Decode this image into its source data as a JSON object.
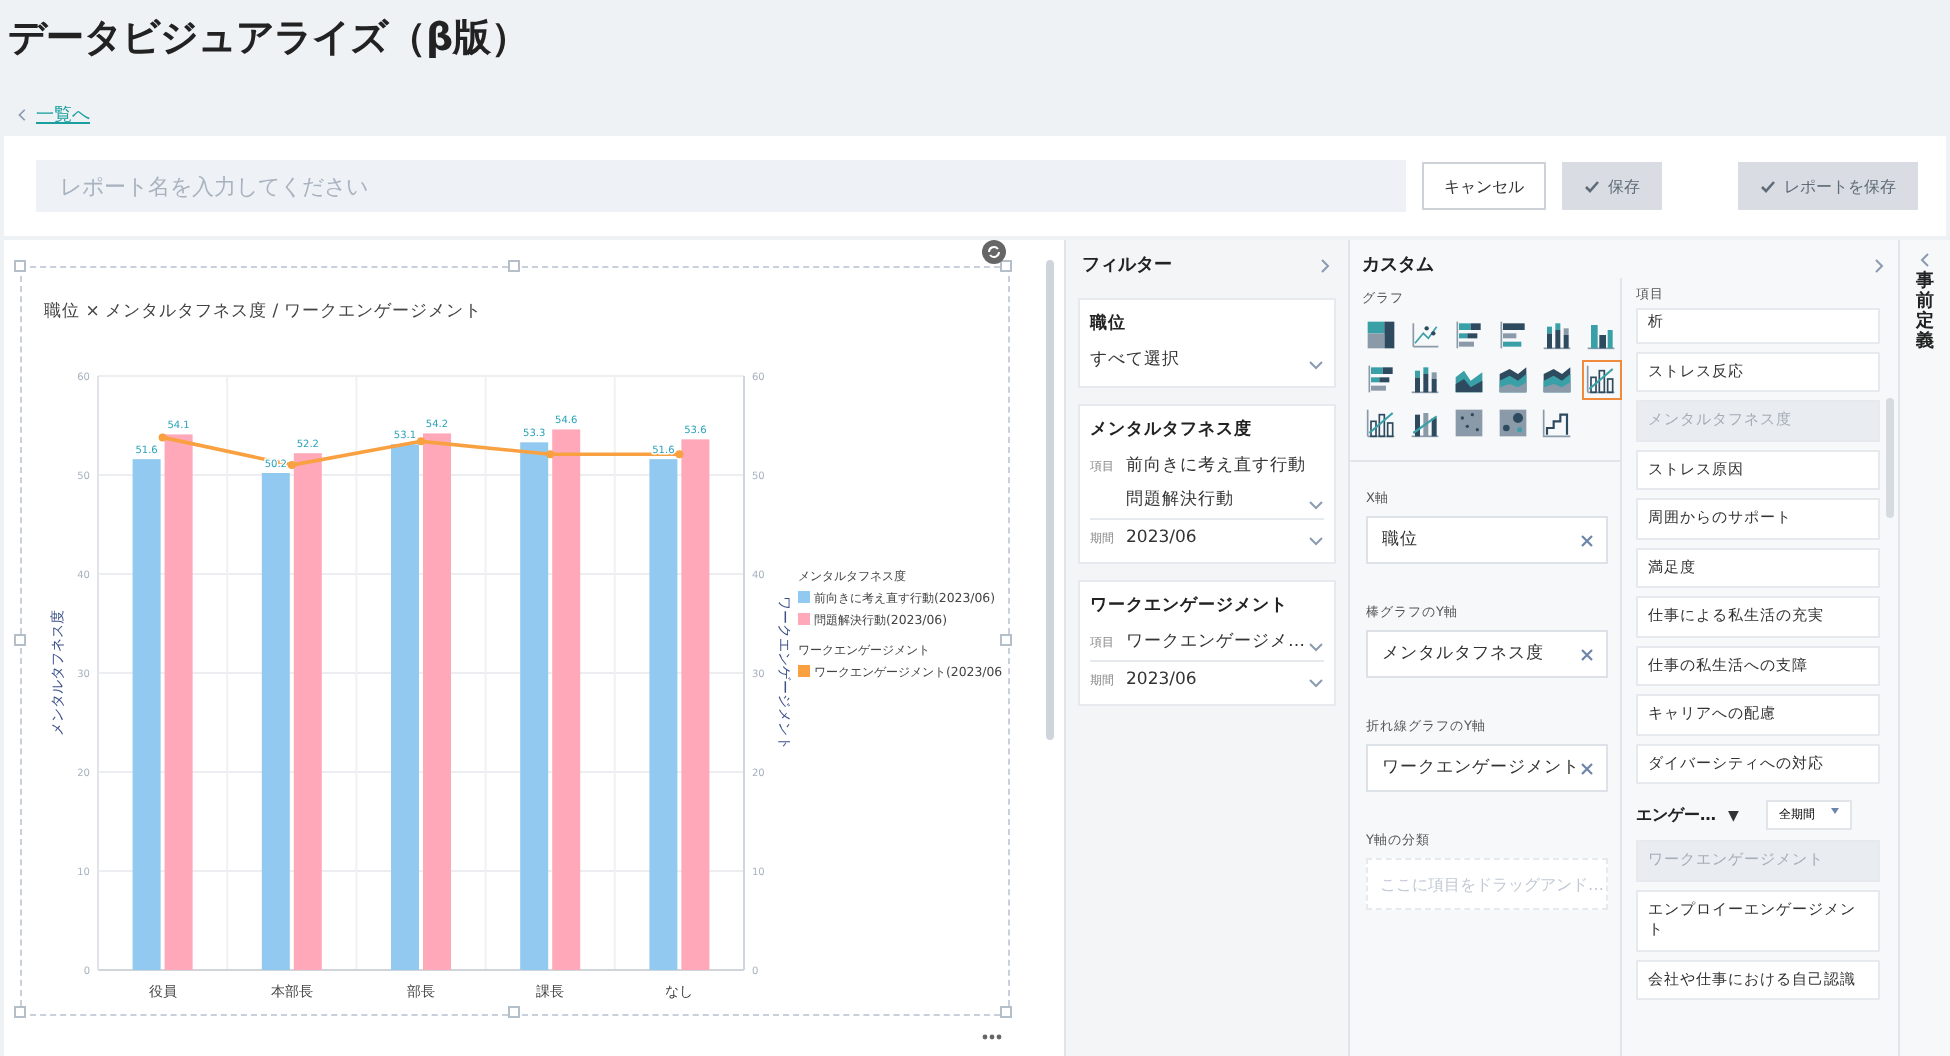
{
  "page": {
    "title": "データビジュアライズ（β版）",
    "back_link": "一覧へ"
  },
  "toolbar": {
    "report_name": {
      "placeholder": "レポート名を入力してください"
    },
    "buttons": [
      {
        "label": "キャンセル",
        "disabled": false
      },
      {
        "label": "保存",
        "disabled": true
      },
      {
        "label": "レポートを保存",
        "disabled": true
      }
    ]
  },
  "chart": {
    "title": "職位 × メンタルタフネス度 / ワークエンゲージメント",
    "legend_headings": {
      "bar": "メンタルタフネス度",
      "line": "ワークエンゲージメント"
    },
    "chart_data": {
      "type": "bar",
      "ylabel": "メンタルタフネス度",
      "y2label": "ワークエンゲージメント",
      "categories": [
        "役員",
        "本部長",
        "部長",
        "課長",
        "なし"
      ],
      "ylim": [
        0,
        60
      ],
      "y2lim": [
        0,
        60
      ],
      "yticks": [
        0,
        10,
        20,
        30,
        40,
        50,
        60
      ],
      "y2ticks": [
        0,
        10,
        20,
        30,
        40,
        50,
        60
      ],
      "grid": true,
      "legend": true,
      "value_labels": [
        [
          "51.6",
          "50.2",
          "53.1",
          "53.3",
          "51.6"
        ],
        [
          "54.1",
          "52.2",
          "54.2",
          "54.6",
          "53.6"
        ],
        [
          null,
          null,
          null,
          null,
          null
        ]
      ],
      "series": [
        {
          "name": "前向きに考え直す行動(2023/06)",
          "type": "bar",
          "color": "#92c9f0",
          "values": [
            51.6,
            50.2,
            53.1,
            53.3,
            51.6
          ]
        },
        {
          "name": "問題解決行動(2023/06)",
          "type": "bar",
          "color": "#ffa8ba",
          "values": [
            54.1,
            52.2,
            54.2,
            54.6,
            53.6
          ]
        },
        {
          "name": "ワークエンゲージメント(2023/06",
          "type": "line",
          "color": "#f9a040",
          "marker": "circle",
          "values": [
            53.8,
            51.0,
            53.4,
            52.1,
            52.1
          ]
        }
      ]
    }
  },
  "filter_panel": {
    "title": "フィルター",
    "filters": [
      {
        "title": "職位",
        "rows": [
          {
            "values": [
              "すべて選択"
            ]
          }
        ]
      },
      {
        "title": "メンタルタフネス度",
        "rows": [
          {
            "label": "項目",
            "values": [
              "前向きに考え直す行動",
              "問題解決行動"
            ]
          },
          {
            "label": "期間",
            "values": [
              "2023/06"
            ]
          }
        ]
      },
      {
        "title": "ワークエンゲージメント",
        "rows": [
          {
            "label": "項目",
            "values": [
              "ワークエンゲージメ…"
            ]
          },
          {
            "label": "期間",
            "values": [
              "2023/06"
            ]
          }
        ]
      }
    ]
  },
  "custom_panel": {
    "title": "カスタム",
    "graph_label": "グラフ",
    "graph_types": [
      {
        "kind": "treemap",
        "selected": false
      },
      {
        "kind": "line-scatter",
        "selected": false
      },
      {
        "kind": "stacked-bar",
        "selected": false
      },
      {
        "kind": "bar",
        "selected": false
      },
      {
        "kind": "stacked-column",
        "selected": false
      },
      {
        "kind": "column",
        "selected": false
      },
      {
        "kind": "stacked-bar",
        "selected": false
      },
      {
        "kind": "stacked-column",
        "selected": false
      },
      {
        "kind": "area",
        "selected": false
      },
      {
        "kind": "stacked-area",
        "selected": false
      },
      {
        "kind": "stacked-area",
        "selected": false
      },
      {
        "kind": "column-line",
        "selected": true
      },
      {
        "kind": "column-line",
        "selected": false
      },
      {
        "kind": "stacked-column-line",
        "selected": false
      },
      {
        "kind": "scatter",
        "selected": false
      },
      {
        "kind": "bubble",
        "selected": false
      },
      {
        "kind": "step",
        "selected": false
      }
    ],
    "axes": [
      {
        "label": "X軸",
        "kind": "chip",
        "value": "職位"
      },
      {
        "label": "棒グラフのY軸",
        "kind": "chip",
        "value": "メンタルタフネス度"
      },
      {
        "label": "折れ線グラフのY軸",
        "kind": "chip",
        "value": "ワークエンゲージメント"
      },
      {
        "label": "Y軸の分類",
        "kind": "drop",
        "placeholder": "ここに項目をドラッグアンド…"
      }
    ]
  },
  "items_panel": {
    "title": "項目",
    "items": [
      {
        "label": "析",
        "disabled": false
      },
      {
        "label": "ストレス反応",
        "disabled": false
      },
      {
        "label": "メンタルタフネス度",
        "disabled": true
      },
      {
        "label": "ストレス原因",
        "disabled": false
      },
      {
        "label": "周囲からのサポート",
        "disabled": false
      },
      {
        "label": "満足度",
        "disabled": false
      },
      {
        "label": "仕事による私生活の充実",
        "disabled": false
      },
      {
        "label": "仕事の私生活への支障",
        "disabled": false
      },
      {
        "label": "キャリアへの配慮",
        "disabled": false
      },
      {
        "label": "ダイバーシティへの対応",
        "disabled": false
      }
    ],
    "group": {
      "title": "エンゲー…",
      "toggle": "▼",
      "period": "全期間",
      "items": [
        {
          "label": "ワークエンゲージメント",
          "disabled": true
        },
        {
          "label": "エンプロイーエンゲージメント",
          "disabled": false
        },
        {
          "label": "会社や仕事における自己認識",
          "disabled": false
        }
      ]
    }
  },
  "side_tab": {
    "label": "事前定義"
  }
}
